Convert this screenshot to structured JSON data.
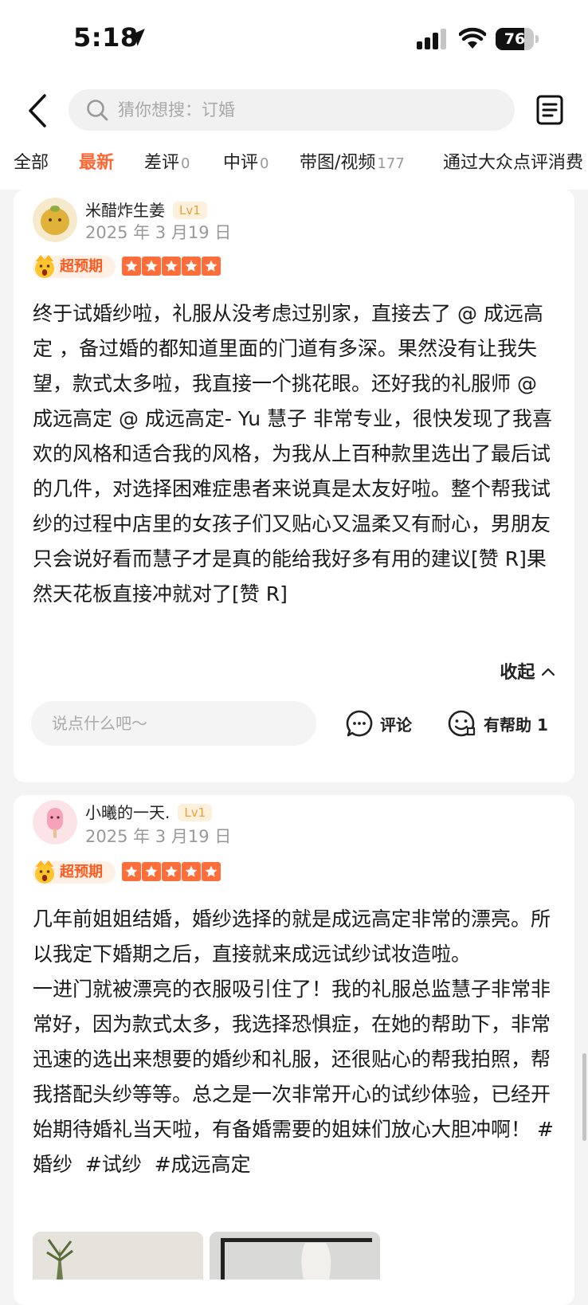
{
  "status": {
    "time": "5:18",
    "battery": "76",
    "battery_level": 0.76
  },
  "header": {
    "search_placeholder": "猜你想搜：订婚",
    "tabs": [
      {
        "label": "全部",
        "count": ""
      },
      {
        "label": "最新",
        "count": ""
      },
      {
        "label": "差评",
        "count": "0"
      },
      {
        "label": "中评",
        "count": "0"
      },
      {
        "label": "带图/视频",
        "count": "177"
      },
      {
        "label": "通过大众点评消费",
        "count": ""
      }
    ],
    "active_tab": 1
  },
  "reviews": [
    {
      "username": "米醋炸生姜",
      "level": "Lv1",
      "date": "2025 年 3 月19 日",
      "badge": "超预期",
      "stars": 5,
      "text": "终于试婚纱啦，礼服从没考虑过别家，直接去了 @ 成远高定 ，备过婚的都知道里面的门道有多深。果然没有让我失望，款式太多啦，我直接一个挑花眼。还好我的礼服师 @ 成远高定 @ 成远高定- Yu 慧子 非常专业，很快发现了我喜欢的风格和适合我的风格，为我从上百种款里选出了最后试的几件，对选择困难症患者来说真是太友好啦。整个帮我试纱的过程中店里的女孩子们又贴心又温柔又有耐心，男朋友只会说好看而慧子才是真的能给我好多有用的建议[赞 R]果然天花板直接冲就对了[赞 R]",
      "collapse_label": "收起",
      "comment_placeholder": "说点什么吧～",
      "comment_label": "评论",
      "helpful_label": "有帮助 1"
    },
    {
      "username": "小曦的一天.",
      "level": "Lv1",
      "date": "2025 年 3 月19 日",
      "badge": "超预期",
      "stars": 5,
      "text": "几年前姐姐结婚，婚纱选择的就是成远高定非常的漂亮。所以我定下婚期之后，直接就来成远试纱试妆造啦。\n一进门就被漂亮的衣服吸引住了！我的礼服总监慧子非常非常好，因为款式太多，我选择恐惧症，在她的帮助下，非常迅速的选出来想要的婚纱和礼服，还很贴心的帮我拍照，帮我搭配头纱等等。总之是一次非常开心的试纱体验，已经开始期待婚礼当天啦，有备婚需要的姐妹们放心大胆冲啊！ #婚纱  #试纱  #成远高定"
    }
  ],
  "colors": {
    "accent": "#ff6633",
    "star": "#ff6e3a",
    "level": "#e8a23c"
  }
}
